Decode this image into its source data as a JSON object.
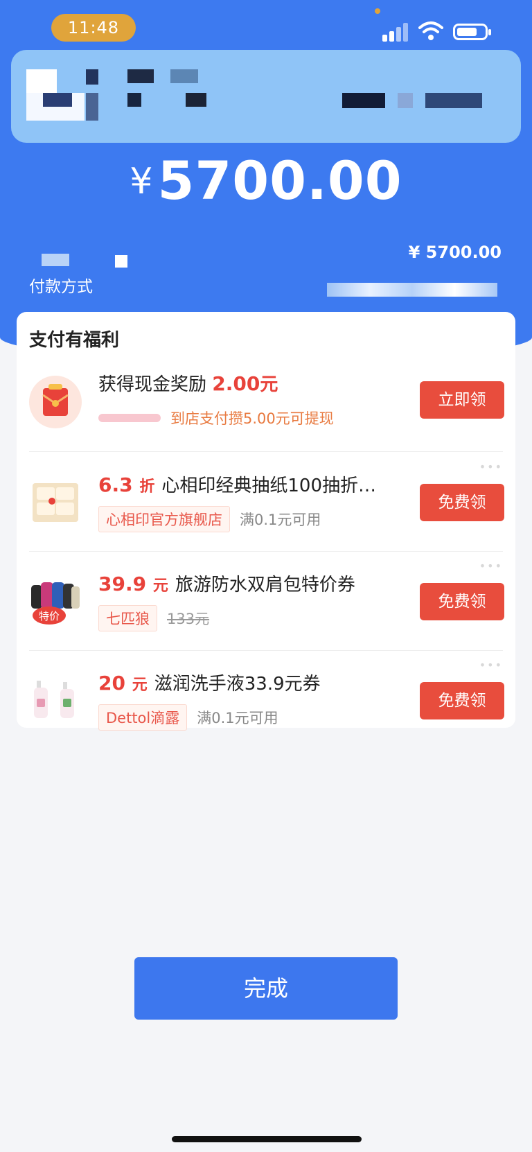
{
  "status_bar": {
    "time": "11:48"
  },
  "payment": {
    "currency_symbol": "¥",
    "amount": "5700.00",
    "method_label": "付款方式",
    "method_amount": "¥ 5700.00"
  },
  "benefits": {
    "title": "支付有福利",
    "cash_reward": {
      "headline": "获得现金奖励",
      "reward_amount": "2.00",
      "reward_unit": "元",
      "note": "到店支付攒5.00元可提现",
      "button": "立即领"
    },
    "offers": [
      {
        "price": "6.3",
        "price_unit": "折",
        "title": "心相印经典抽纸100抽折…",
        "tag": "心相印官方旗舰店",
        "note": "满0.1元可用",
        "button": "免费领"
      },
      {
        "price": "39.9",
        "price_unit": "元",
        "title": "旅游防水双肩包特价券",
        "tag": "七匹狼",
        "note": "133元",
        "thumb_badge": "特价",
        "button": "免费领"
      },
      {
        "price": "20",
        "price_unit": "元",
        "title": "滋润洗手液33.9元券",
        "tag": "Dettol滴露",
        "note": "满0.1元可用",
        "button": "免费领"
      }
    ]
  },
  "done_button": "完成",
  "colors": {
    "brand_blue": "#3d7af0",
    "accent_red": "#e84d3d",
    "card_light_blue": "#8fc4f7"
  },
  "icons": [
    "signal-icon",
    "wifi-icon",
    "battery-icon",
    "red-envelope-icon",
    "tissue-product-image",
    "backpack-product-image",
    "handwash-product-image"
  ]
}
